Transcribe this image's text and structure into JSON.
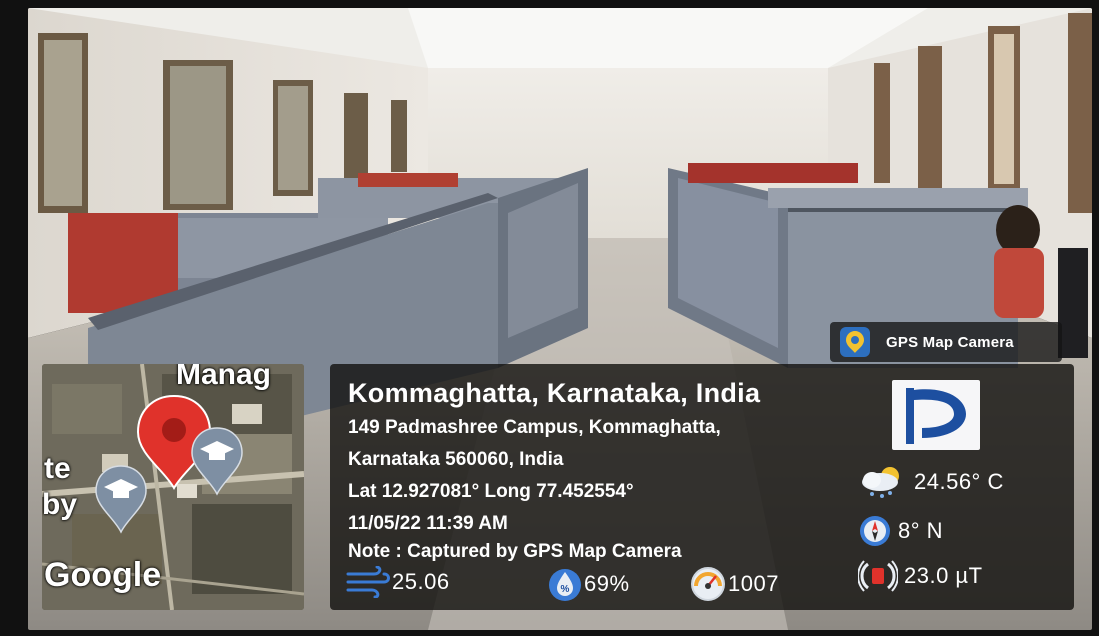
{
  "badge": {
    "label": "GPS Map Camera",
    "icon": "map-pin-app-icon"
  },
  "map": {
    "labels": {
      "top": "Manag",
      "left1": "te",
      "left2": "by",
      "brand": "Google"
    },
    "marker_icon": "red-map-pin-icon",
    "poi_icon": "graduation-cap-icon"
  },
  "location": {
    "title": "Kommaghatta, Karnataka, India",
    "address_line1": "149 Padmashree Campus, Kommaghatta,",
    "address_line2": "Karnataka 560060, India",
    "lat_long": "Lat 12.927081° Long 77.452554°",
    "datetime": "11/05/22 11:39 AM",
    "note": "Note : Captured by GPS Map Camera"
  },
  "metrics": {
    "wind": {
      "value": "25.06",
      "icon": "wind-icon"
    },
    "humidity": {
      "value": "69%",
      "icon": "humidity-drop-icon"
    },
    "pressure": {
      "value": "1007",
      "icon": "pressure-gauge-icon"
    },
    "temperature": {
      "value": "24.56° C",
      "icon": "weather-cloud-icon"
    },
    "direction": {
      "value": "8° N",
      "icon": "compass-icon"
    },
    "magnetic": {
      "value": "23.0 µT",
      "icon": "magnetic-field-icon"
    }
  },
  "logo": {
    "icon": "padmashree-logo"
  },
  "colors": {
    "accent_blue": "#1d4fa0",
    "panel": "#121010",
    "pin_red": "#e0322b"
  }
}
